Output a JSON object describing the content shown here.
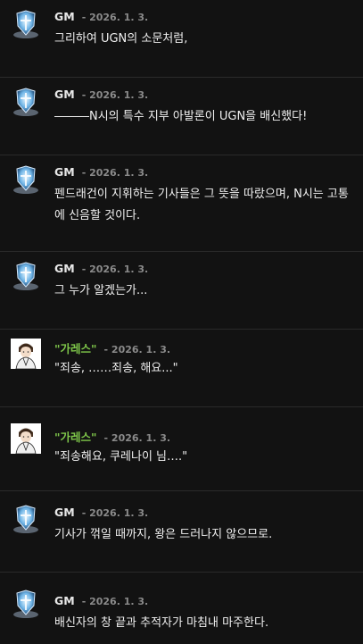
{
  "messages": [
    {
      "author": "GM",
      "author_type": "gm",
      "avatar": "shield-emblem-icon",
      "date": "- 2026. 1. 3.",
      "text": "그리하여 UGN의 소문처럼,"
    },
    {
      "author": "GM",
      "author_type": "gm",
      "avatar": "shield-emblem-icon",
      "date": "- 2026. 1. 3.",
      "text": "―――N시의 특수 지부 아발론이 UGN을 배신했다!"
    },
    {
      "author": "GM",
      "author_type": "gm",
      "avatar": "shield-emblem-icon",
      "date": "- 2026. 1. 3.",
      "text": "펜드래건이 지휘하는 기사들은 그 뜻을 따랐으며, N시는 고통에 신음할 것이다."
    },
    {
      "author": "GM",
      "author_type": "gm",
      "avatar": "shield-emblem-icon",
      "date": "- 2026. 1. 3.",
      "text": "그 누가 알겠는가..."
    },
    {
      "author": "\"가레스\"",
      "author_type": "character",
      "avatar": "character-portrait-icon",
      "date": "- 2026. 1. 3.",
      "text": "\"죄송, ……죄송, 해요...\""
    },
    {
      "author": "\"가레스\"",
      "author_type": "character",
      "avatar": "character-portrait-icon",
      "date": "- 2026. 1. 3.",
      "text": "\"죄송해요, 쿠레나이 님….\""
    },
    {
      "author": "GM",
      "author_type": "gm",
      "avatar": "shield-emblem-icon",
      "date": "- 2026. 1. 3.",
      "text": "기사가 꺾일 때까지, 왕은 드러나지 않으므로."
    },
    {
      "author": "GM",
      "author_type": "gm",
      "avatar": "shield-emblem-icon",
      "date": "- 2026. 1. 3.",
      "text": "배신자의 창 끝과 추적자가 마침내 마주한다."
    }
  ],
  "colors": {
    "gm_name": "#e8e8e8",
    "character_name": "#7fc74a",
    "date": "#8a8a8a",
    "background": "#121212"
  }
}
